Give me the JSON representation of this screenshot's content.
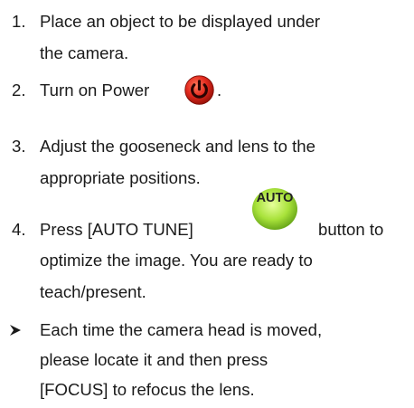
{
  "colors": {
    "text": "#1a1a1a",
    "power_red": "#e32a1e",
    "auto_green": "#a8e23a"
  },
  "icons": {
    "power": "power-button-icon",
    "auto": "auto-tune-button-icon",
    "bullet": "arrow-bullet-icon"
  },
  "steps": [
    {
      "number": "1.",
      "lines": [
        "Place an object to be displayed under",
        "the camera."
      ]
    },
    {
      "number": "2.",
      "lines": [
        "Turn on Power",
        "."
      ]
    },
    {
      "number": "3.",
      "lines": [
        "Adjust the gooseneck and lens to the",
        "appropriate positions."
      ]
    },
    {
      "number": "4.",
      "lines": [
        "Press [AUTO TUNE]",
        "button to",
        "optimize the image. You are ready to",
        "teach/present."
      ],
      "icon_label": "AUTO"
    }
  ],
  "note": {
    "lines": [
      "Each time the camera head is moved,",
      "please locate it and then press",
      "[FOCUS] to refocus the lens."
    ]
  }
}
